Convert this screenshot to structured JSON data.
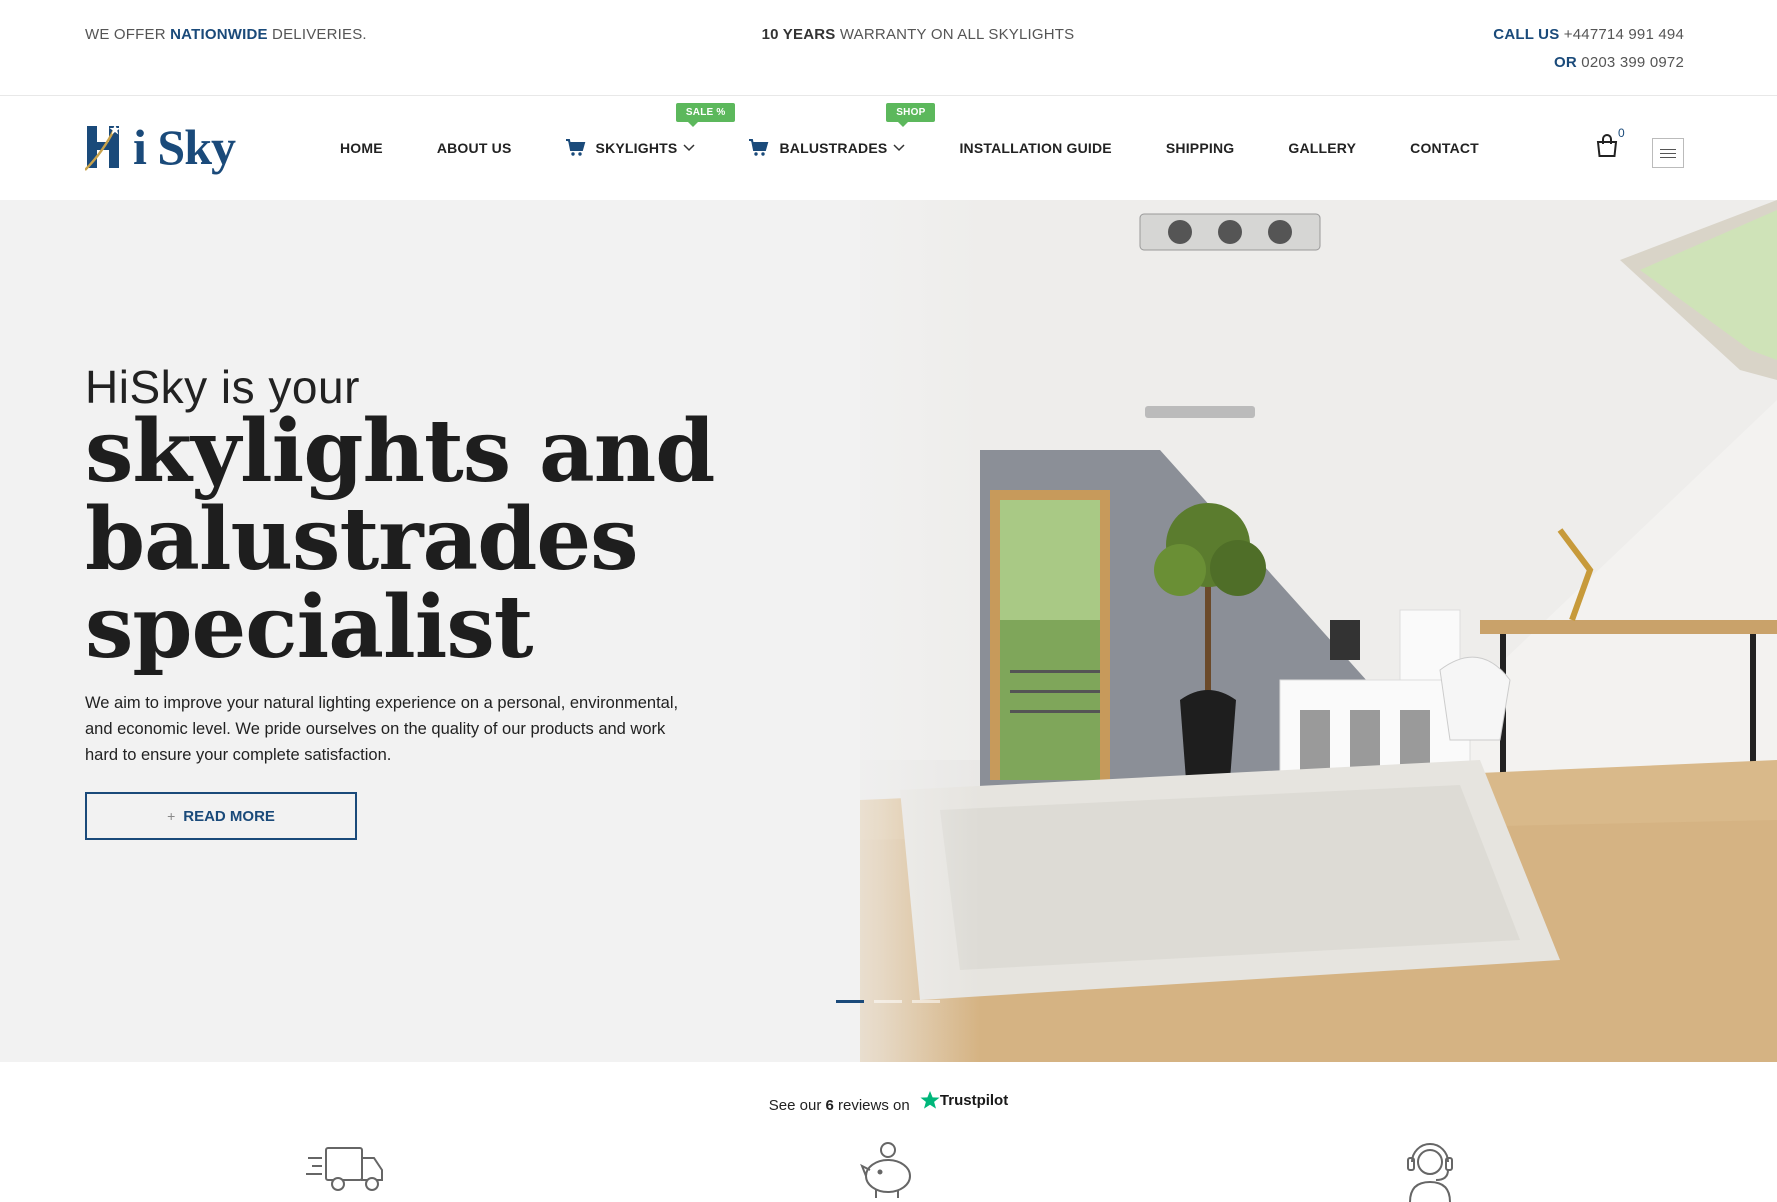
{
  "topbar": {
    "left_pre": "WE OFFER ",
    "left_em": "NATIONWIDE",
    "left_post": " DELIVERIES.",
    "center_em": "10 YEARS",
    "center_post": " WARRANTY ON ALL SKYLIGHTS",
    "call_label": "CALL US",
    "call_number": "+447714 991 494",
    "or_label": "OR",
    "or_number": "0203 399 0972"
  },
  "header": {
    "logo_text": "i Sky",
    "nav": [
      {
        "label": "HOME"
      },
      {
        "label": "ABOUT US"
      },
      {
        "label": "SKYLIGHTS",
        "badge": "SALE %"
      },
      {
        "label": "BALUSTRADES",
        "badge": "SHOP"
      },
      {
        "label": "INSTALLATION GUIDE"
      },
      {
        "label": "SHIPPING"
      },
      {
        "label": "GALLERY"
      },
      {
        "label": "CONTACT"
      }
    ],
    "cart_count": "0"
  },
  "hero": {
    "intro": "HiSky is your",
    "title_line1": "skylights and",
    "title_line2": "balustrades",
    "title_line3": "specialist",
    "description": "We aim to improve your natural lighting experience on a personal, environmental, and economic level. We pride ourselves on the quality of our products and work hard to ensure your complete satisfaction.",
    "button_label": "READ MORE",
    "button_plus": "+",
    "slides_total": 3,
    "slide_active": 1
  },
  "trust": {
    "pre": "See our ",
    "count": "6",
    "post": " reviews on",
    "brand": "Trustpilot"
  },
  "colors": {
    "brand_blue": "#1a4a7a",
    "badge_green": "#5cb85c",
    "hero_bg": "#f2f2f2",
    "trustpilot_green": "#00b67a"
  },
  "icons": [
    "cart-icon",
    "chevron-down-icon",
    "shopping-bag-icon",
    "hamburger-menu-icon",
    "star-icon",
    "delivery-truck-icon",
    "piggy-bank-icon",
    "support-agent-icon"
  ]
}
